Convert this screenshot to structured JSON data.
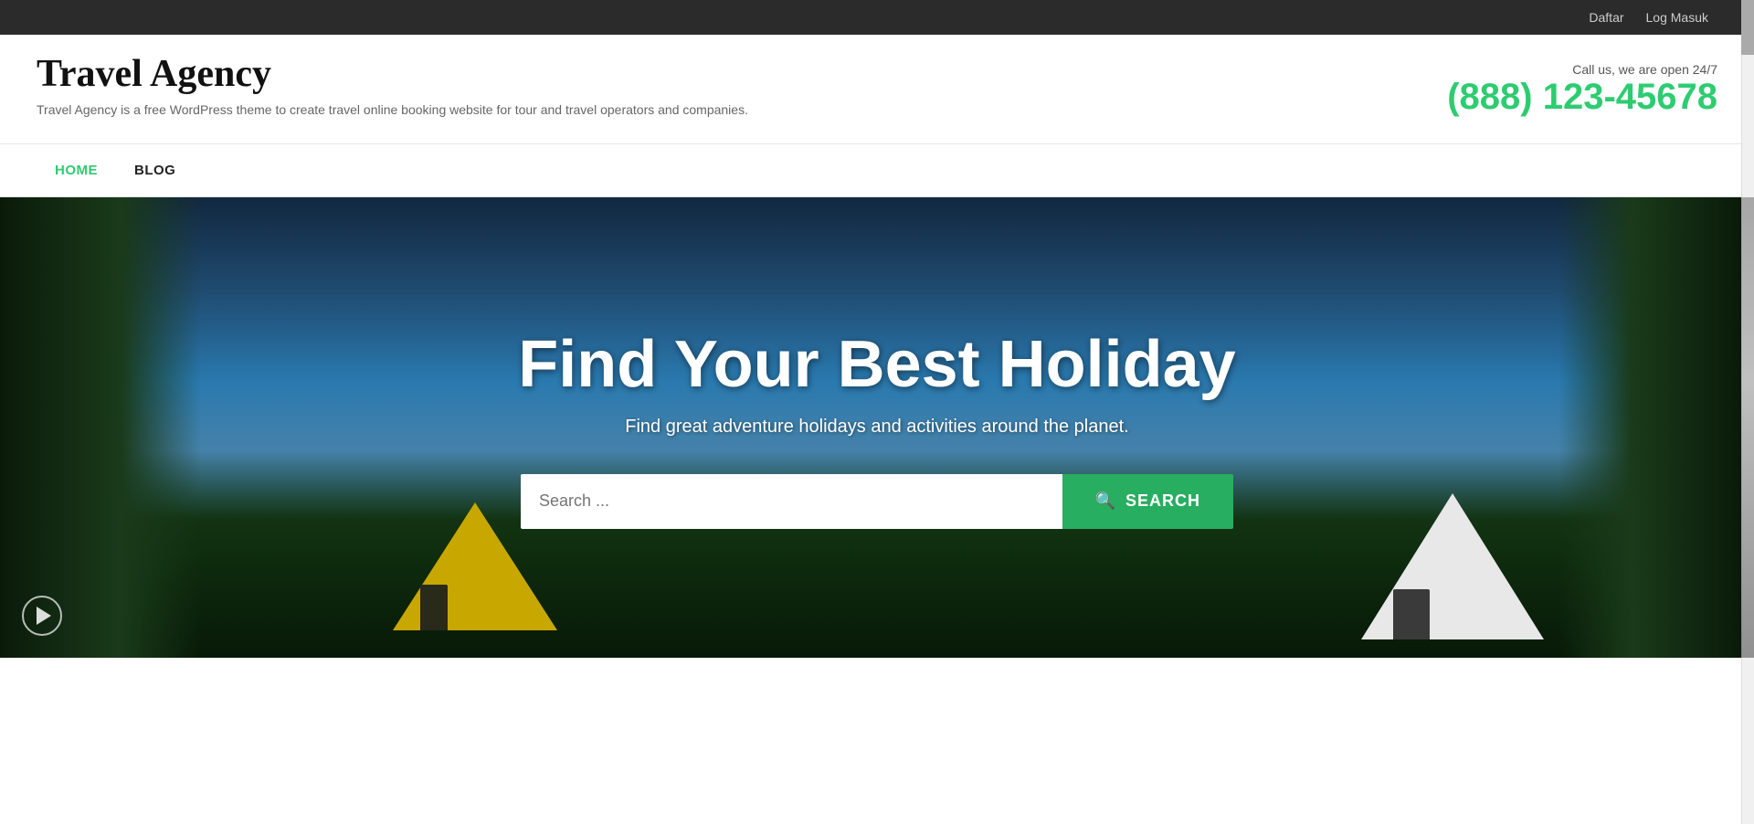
{
  "topbar": {
    "register_label": "Daftar",
    "login_label": "Log Masuk"
  },
  "header": {
    "site_title": "Travel Agency",
    "site_tagline": "Travel Agency is a free WordPress theme to create travel online booking website for tour and travel operators and companies.",
    "call_label": "Call us, we are open 24/7",
    "phone_number": "(888) 123-45678"
  },
  "nav": {
    "items": [
      {
        "label": "HOME",
        "active": true
      },
      {
        "label": "BLOG",
        "active": false
      }
    ]
  },
  "hero": {
    "title": "Find Your Best Holiday",
    "subtitle": "Find great adventure holidays and activities around the planet.",
    "search_placeholder": "Search ...",
    "search_button_label": "SEARCH"
  }
}
